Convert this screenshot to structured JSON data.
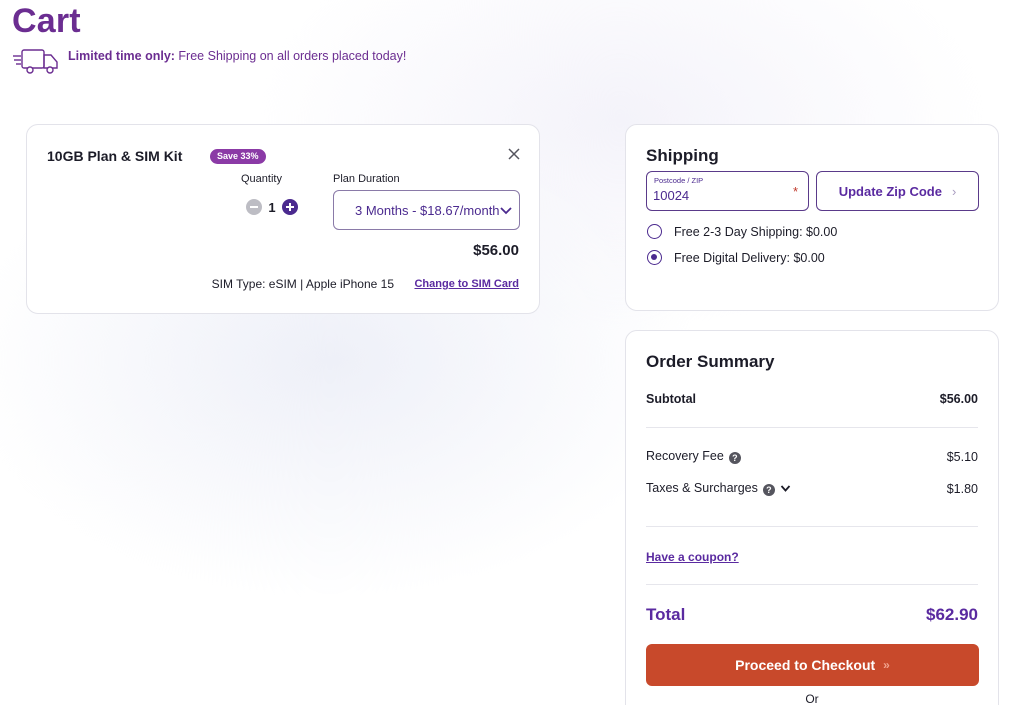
{
  "page": {
    "title": "Cart"
  },
  "promo": {
    "bold": "Limited time only:",
    "text": " Free Shipping on all orders placed today!"
  },
  "cart_item": {
    "title": "10GB Plan & SIM Kit",
    "badge": "Save 33%",
    "quantity_label": "Quantity",
    "quantity": "1",
    "duration_label": "Plan Duration",
    "duration_value": "3 Months - $18.67/month",
    "price": "$56.00",
    "sim_type": "SIM Type:  eSIM | Apple iPhone 15",
    "sim_change_link": "Change to SIM Card"
  },
  "shipping": {
    "title": "Shipping",
    "zip_label": "Postcode / ZIP",
    "zip_value": "10024",
    "required_mark": "*",
    "update_button": "Update Zip Code",
    "options": [
      {
        "label": "Free 2-3 Day Shipping: $0.00",
        "selected": false
      },
      {
        "label": "Free Digital Delivery: $0.00",
        "selected": true
      }
    ]
  },
  "summary": {
    "title": "Order Summary",
    "subtotal_label": "Subtotal",
    "subtotal_value": "$56.00",
    "recovery_label": "Recovery Fee",
    "recovery_value": "$5.10",
    "taxes_label": "Taxes & Surcharges",
    "taxes_value": "$1.80",
    "coupon_link": "Have a coupon?",
    "total_label": "Total",
    "total_value": "$62.90",
    "checkout_button": "Proceed to Checkout",
    "or_text": "Or"
  },
  "colors": {
    "brand_purple": "#6b2d91",
    "checkout_orange": "#c8492b"
  },
  "icons": [
    "delivery-truck-icon",
    "close-icon",
    "minus-icon",
    "plus-icon",
    "chevron-down-icon",
    "chevron-right-icon",
    "help-icon",
    "double-chevron-right-icon"
  ]
}
